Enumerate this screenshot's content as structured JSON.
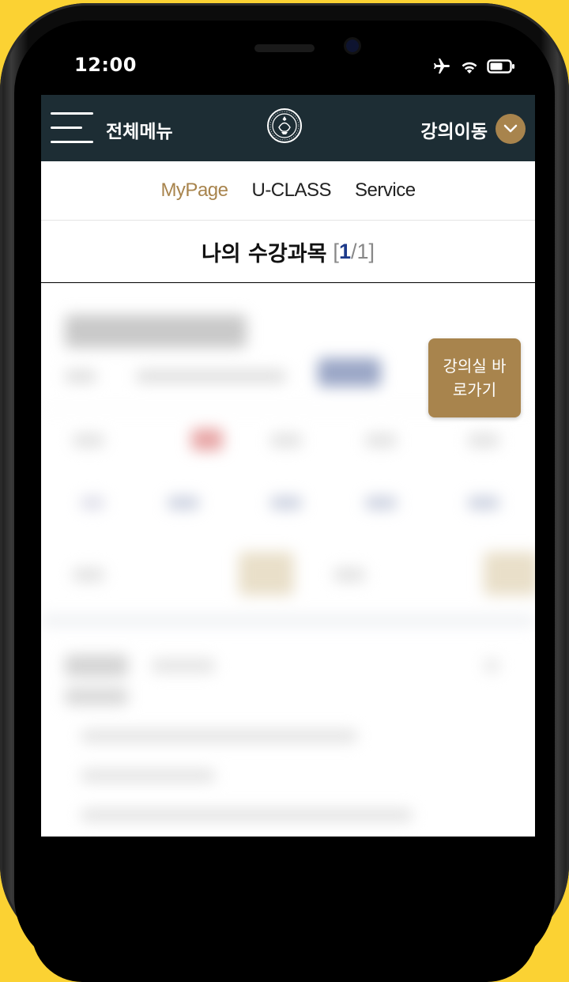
{
  "status_bar": {
    "time": "12:00",
    "icons": [
      "airplane-icon",
      "wifi-icon",
      "battery-icon"
    ]
  },
  "header": {
    "menu_label": "전체메뉴",
    "logo_icon": "university-emblem-icon",
    "move_label": "강의이동"
  },
  "tabs": [
    {
      "label": "MyPage",
      "active": true
    },
    {
      "label": "U-CLASS",
      "active": false
    },
    {
      "label": "Service",
      "active": false
    }
  ],
  "section": {
    "title": "나의 수강과목",
    "current": "1",
    "total": "/1"
  },
  "float_button": {
    "label": "강의실 바로가기"
  },
  "colors": {
    "background": "#fbd233",
    "header": "#1d2d34",
    "accent": "#a8844d",
    "page_index": "#1d3a8a"
  }
}
